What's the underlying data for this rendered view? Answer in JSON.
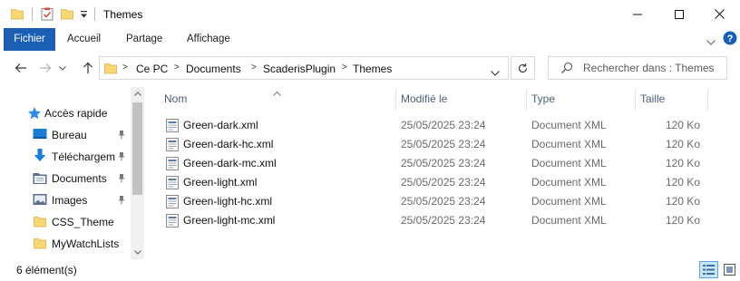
{
  "window": {
    "title": "Themes",
    "controls": {
      "minimize": "minimize",
      "maximize": "maximize",
      "close": "close"
    }
  },
  "ribbon": {
    "tabs": [
      "Fichier",
      "Accueil",
      "Partage",
      "Affichage"
    ]
  },
  "address": {
    "crumbs": [
      "Ce PC",
      "Documents",
      "ScaderisPlugin",
      "Themes"
    ]
  },
  "search": {
    "placeholder": "Rechercher dans : Themes"
  },
  "sidebar": {
    "items": [
      {
        "label": "Accès rapide",
        "icon": "star-icon",
        "pinned": false
      },
      {
        "label": "Bureau",
        "icon": "desktop-icon",
        "pinned": true
      },
      {
        "label": "Téléchargements",
        "icon": "download-icon",
        "pinned": true
      },
      {
        "label": "Documents",
        "icon": "documents-icon",
        "pinned": true
      },
      {
        "label": "Images",
        "icon": "pictures-icon",
        "pinned": true
      },
      {
        "label": "CSS_Theme",
        "icon": "folder-icon",
        "pinned": false
      },
      {
        "label": "MyWatchLists",
        "icon": "folder-icon",
        "pinned": false
      }
    ]
  },
  "filelist": {
    "columns": [
      "Nom",
      "Modifié le",
      "Type",
      "Taille"
    ],
    "rows": [
      {
        "name": "Green-dark.xml",
        "modified": "25/05/2025 23:24",
        "type": "Document XML",
        "size": "120 Ko"
      },
      {
        "name": "Green-dark-hc.xml",
        "modified": "25/05/2025 23:24",
        "type": "Document XML",
        "size": "120 Ko"
      },
      {
        "name": "Green-dark-mc.xml",
        "modified": "25/05/2025 23:24",
        "type": "Document XML",
        "size": "120 Ko"
      },
      {
        "name": "Green-light.xml",
        "modified": "25/05/2025 23:24",
        "type": "Document XML",
        "size": "120 Ko"
      },
      {
        "name": "Green-light-hc.xml",
        "modified": "25/05/2025 23:24",
        "type": "Document XML",
        "size": "120 Ko"
      },
      {
        "name": "Green-light-mc.xml",
        "modified": "25/05/2025 23:24",
        "type": "Document XML",
        "size": "120 Ko"
      }
    ]
  },
  "status": {
    "count": "6 élément(s)"
  },
  "colors": {
    "accent": "#1a5fb4",
    "folder": "#f8d775",
    "header_text": "#4c607a",
    "secondary_text": "#6a6a6a"
  }
}
